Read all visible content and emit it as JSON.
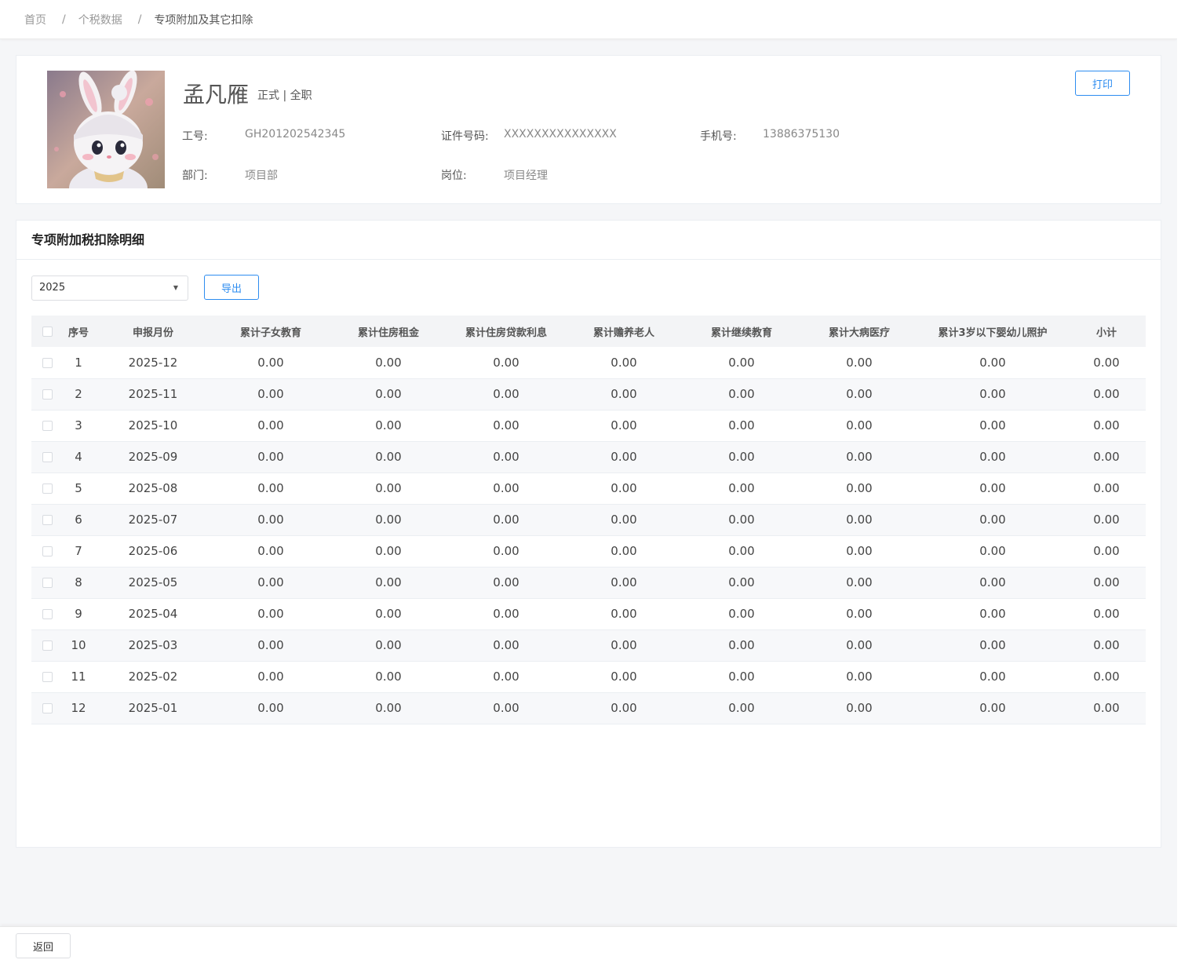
{
  "breadcrumb": {
    "items": [
      "首页",
      "个税数据",
      "专项附加及其它扣除"
    ],
    "separator": "/"
  },
  "profile": {
    "name": "孟凡雁",
    "status": "正式 | 全职",
    "fields": {
      "emp_no_label": "工号:",
      "emp_no": "GH201202542345",
      "id_label": "证件号码:",
      "id_no": "XXXXXXXXXXXXXXX",
      "phone_label": "手机号:",
      "phone": "13886375130",
      "dept_label": "部门:",
      "dept": "项目部",
      "post_label": "岗位:",
      "post": "项目经理"
    },
    "print_label": "打印"
  },
  "detail": {
    "title": "专项附加税扣除明细",
    "year_select": "2025",
    "export_label": "导出",
    "columns": [
      "序号",
      "申报月份",
      "累计子女教育",
      "累计住房租金",
      "累计住房贷款利息",
      "累计赡养老人",
      "累计继续教育",
      "累计大病医疗",
      "累计3岁以下婴幼儿照护",
      "小计"
    ],
    "rows": [
      [
        "1",
        "2025-12",
        "0.00",
        "0.00",
        "0.00",
        "0.00",
        "0.00",
        "0.00",
        "0.00",
        "0.00"
      ],
      [
        "2",
        "2025-11",
        "0.00",
        "0.00",
        "0.00",
        "0.00",
        "0.00",
        "0.00",
        "0.00",
        "0.00"
      ],
      [
        "3",
        "2025-10",
        "0.00",
        "0.00",
        "0.00",
        "0.00",
        "0.00",
        "0.00",
        "0.00",
        "0.00"
      ],
      [
        "4",
        "2025-09",
        "0.00",
        "0.00",
        "0.00",
        "0.00",
        "0.00",
        "0.00",
        "0.00",
        "0.00"
      ],
      [
        "5",
        "2025-08",
        "0.00",
        "0.00",
        "0.00",
        "0.00",
        "0.00",
        "0.00",
        "0.00",
        "0.00"
      ],
      [
        "6",
        "2025-07",
        "0.00",
        "0.00",
        "0.00",
        "0.00",
        "0.00",
        "0.00",
        "0.00",
        "0.00"
      ],
      [
        "7",
        "2025-06",
        "0.00",
        "0.00",
        "0.00",
        "0.00",
        "0.00",
        "0.00",
        "0.00",
        "0.00"
      ],
      [
        "8",
        "2025-05",
        "0.00",
        "0.00",
        "0.00",
        "0.00",
        "0.00",
        "0.00",
        "0.00",
        "0.00"
      ],
      [
        "9",
        "2025-04",
        "0.00",
        "0.00",
        "0.00",
        "0.00",
        "0.00",
        "0.00",
        "0.00",
        "0.00"
      ],
      [
        "10",
        "2025-03",
        "0.00",
        "0.00",
        "0.00",
        "0.00",
        "0.00",
        "0.00",
        "0.00",
        "0.00"
      ],
      [
        "11",
        "2025-02",
        "0.00",
        "0.00",
        "0.00",
        "0.00",
        "0.00",
        "0.00",
        "0.00",
        "0.00"
      ],
      [
        "12",
        "2025-01",
        "0.00",
        "0.00",
        "0.00",
        "0.00",
        "0.00",
        "0.00",
        "0.00",
        "0.00"
      ]
    ]
  },
  "footer": {
    "back_label": "返回"
  },
  "icons": {
    "select_arrow": "caret-down-icon",
    "avatar": "bunny-avatar-image"
  },
  "colors": {
    "primary": "#2d8cf0",
    "background": "#f5f6f8"
  }
}
